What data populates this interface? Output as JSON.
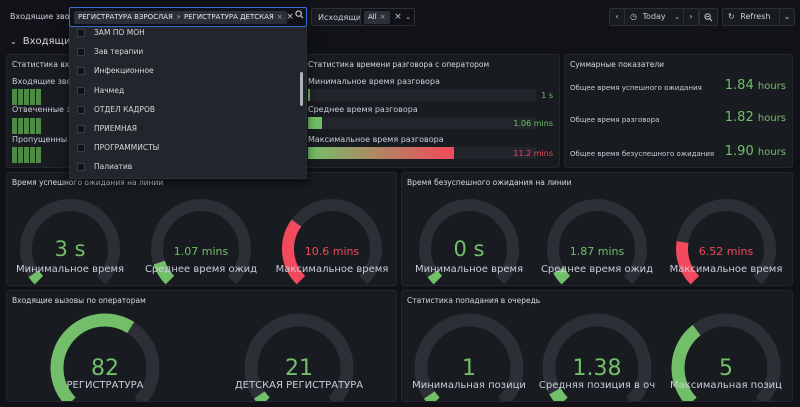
{
  "topbar": {
    "incoming_label": "Входящие звонки",
    "selected": [
      "РЕГИСТРАТУРА ВЗРОСЛАЯ",
      "РЕГИСТРАТУРА ДЕТСКАЯ"
    ],
    "outgoing_label": "Исходящие",
    "outgoing_value": "All",
    "time_label": "Today",
    "refresh_label": "Refresh"
  },
  "row": {
    "title": "Входящие з"
  },
  "dropdown": {
    "items": [
      "ЗАМ ПО МОН",
      "Зав терапии",
      "Инфекционное",
      "Начмед",
      "ОТДЕЛ КАДРОВ",
      "ПРИЕМНАЯ",
      "ПРОГРАММИСТЫ",
      "Палиатив"
    ]
  },
  "panels": {
    "incoming_stats": {
      "title": "Статистика входя",
      "labels": [
        "Входящие зво",
        "Отвеченные з",
        "Пропущенны"
      ]
    },
    "talk_time": {
      "title": "Статистика времени разговора с оператором",
      "rows": [
        {
          "label": "Минимальное время разговора",
          "value": "1 s",
          "fill": 0.01,
          "color": "#73bf69"
        },
        {
          "label": "Среднее время разговора",
          "value": "1.06 mins",
          "fill": 0.06,
          "color": "#73bf69"
        },
        {
          "label": "Максимальное время разговора",
          "value": "11.2 mins",
          "fill": 0.64,
          "color": "#f2495c"
        }
      ]
    },
    "summary": {
      "title": "Суммарные показатели",
      "rows": [
        {
          "label": "Общее время успешного ожидания",
          "value": "1.84",
          "unit": "hours"
        },
        {
          "label": "Общее время разговора",
          "value": "1.82",
          "unit": "hours"
        },
        {
          "label": "Общее время безуспешного ожидания",
          "value": "1.90",
          "unit": "hours"
        }
      ]
    },
    "wait_success": {
      "title": "Время успешного ожидания на линии",
      "gauges": [
        {
          "value": "3 s",
          "label": "Минимальное время",
          "frac": 0.01,
          "color": "#73bf69",
          "big": true
        },
        {
          "value": "1.07 mins",
          "label": "Среднее время ожид",
          "frac": 0.1,
          "color": "#73bf69",
          "big": false
        },
        {
          "value": "10.6 mins",
          "label": "Максимальное время",
          "frac": 0.3,
          "color": "#f2495c",
          "big": false
        }
      ]
    },
    "wait_fail": {
      "title": "Время безуспешного ожидания на линии",
      "gauges": [
        {
          "value": "0 s",
          "label": "Минимальное время",
          "frac": 0.0,
          "color": "#73bf69",
          "big": true
        },
        {
          "value": "1.87 mins",
          "label": "Среднее время ожид",
          "frac": 0.06,
          "color": "#73bf69",
          "big": false
        },
        {
          "value": "6.52 mins",
          "label": "Максимальное время",
          "frac": 0.2,
          "color": "#f2495c",
          "big": false
        }
      ]
    },
    "by_operator": {
      "title": "Входящие вызовы по операторам",
      "gauges": [
        {
          "value": "82",
          "label": "РЕГИСТРАТУРА",
          "frac": 0.62,
          "color": "#73bf69"
        },
        {
          "value": "21",
          "label": "ДЕТСКАЯ РЕГИСТРАТУРА",
          "frac": 0.0,
          "color": "#73bf69"
        }
      ]
    },
    "queue": {
      "title": "Статистика попадания в очередь",
      "gauges": [
        {
          "value": "1",
          "label": "Минимальная позици",
          "frac": 0.0,
          "color": "#73bf69"
        },
        {
          "value": "1.38",
          "label": "Средняя позиция в оч",
          "frac": 0.06,
          "color": "#73bf69"
        },
        {
          "value": "5",
          "label": "Максимальная позиц",
          "frac": 0.36,
          "color": "#73bf69"
        }
      ]
    }
  }
}
